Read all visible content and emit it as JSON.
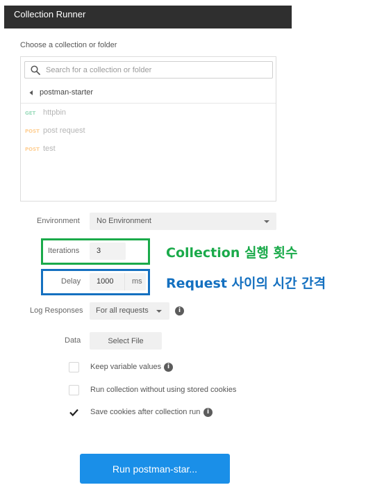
{
  "window": {
    "title": "Collection Runner"
  },
  "collection_picker": {
    "label": "Choose a collection or folder",
    "search_placeholder": "Search for a collection or folder",
    "breadcrumb": "postman-starter",
    "requests": [
      {
        "method": "GET",
        "name": "httpbin"
      },
      {
        "method": "POST",
        "name": "post request"
      },
      {
        "method": "POST",
        "name": "test"
      }
    ]
  },
  "settings": {
    "environment": {
      "label": "Environment",
      "value": "No Environment"
    },
    "iterations": {
      "label": "Iterations",
      "value": "3"
    },
    "delay": {
      "label": "Delay",
      "value": "1000",
      "unit": "ms"
    },
    "log_responses": {
      "label": "Log Responses",
      "value": "For all requests"
    },
    "data": {
      "label": "Data",
      "button": "Select File"
    }
  },
  "options": [
    {
      "label": "Keep variable values",
      "checked": false,
      "info": true
    },
    {
      "label": "Run collection without using stored cookies",
      "checked": false,
      "info": false
    },
    {
      "label": "Save cookies after collection run",
      "checked": true,
      "info": true
    }
  ],
  "run_button": "Run postman-star...",
  "annotations": {
    "iterations_note": "Collection 실행 횟수",
    "delay_note": "Request 사이의 시간 간격",
    "iterations_color": "#1aaa4a",
    "delay_color": "#1470c0"
  },
  "colors": {
    "accent": "#1a8fe8",
    "get_method": "#9ddcbd",
    "post_method": "#ffcf93"
  }
}
